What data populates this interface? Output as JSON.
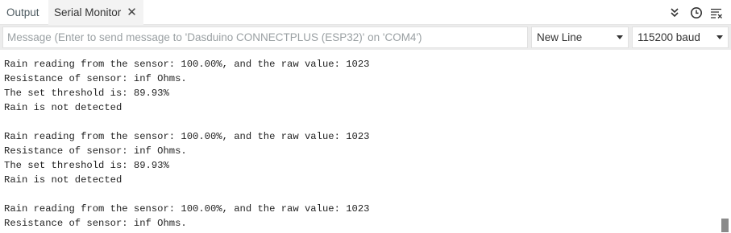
{
  "tabs": {
    "output_label": "Output",
    "serial_label": "Serial Monitor",
    "close_glyph": "✕"
  },
  "toolbar": {
    "icons": [
      "autoscroll-icon",
      "timestamp-icon",
      "clear-output-icon"
    ]
  },
  "input": {
    "placeholder": "Message (Enter to send message to 'Dasduino CONNECTPLUS (ESP32)' on 'COM4')",
    "value": ""
  },
  "line_ending": {
    "selected": "New Line"
  },
  "baud_rate": {
    "selected": "115200 baud"
  },
  "output": {
    "lines": [
      "Rain reading from the sensor: 100.00%, and the raw value: 1023",
      "Resistance of sensor: inf Ohms.",
      "The set threshold is: 89.93%",
      "Rain is not detected",
      "",
      "Rain reading from the sensor: 100.00%, and the raw value: 1023",
      "Resistance of sensor: inf Ohms.",
      "The set threshold is: 89.93%",
      "Rain is not detected",
      "",
      "Rain reading from the sensor: 100.00%, and the raw value: 1023",
      "Resistance of sensor: inf Ohms."
    ]
  },
  "colors": {
    "toolbar_bg": "#ffffff",
    "input_row_bg": "#ececec",
    "active_tab_bg": "#f3f3f3",
    "scrollbar_thumb": "#8a8a8a"
  }
}
